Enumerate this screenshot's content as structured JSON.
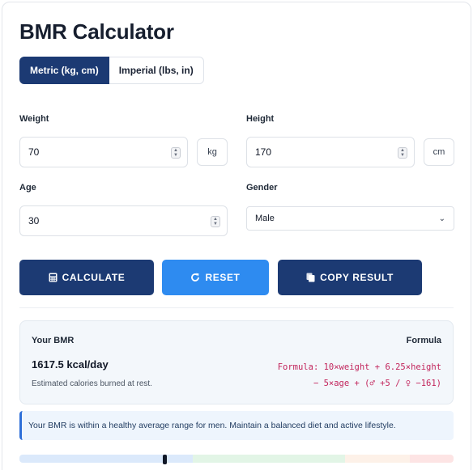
{
  "title": "BMR Calculator",
  "units": {
    "metric": "Metric (kg, cm)",
    "imperial": "Imperial (lbs, in)",
    "selected": "metric"
  },
  "fields": {
    "weight": {
      "label": "Weight",
      "value": "70",
      "unit": "kg"
    },
    "height": {
      "label": "Height",
      "value": "170",
      "unit": "cm"
    },
    "age": {
      "label": "Age",
      "value": "30"
    },
    "gender": {
      "label": "Gender",
      "value": "Male"
    }
  },
  "buttons": {
    "calculate": "CALCULATE",
    "reset": "RESET",
    "copy": "COPY RESULT"
  },
  "result": {
    "label": "Your BMR",
    "value": "1617.5 kcal/day",
    "note": "Estimated calories burned at rest.",
    "formula_label": "Formula",
    "formula_line1": "Formula: 10×weight + 6.25×height",
    "formula_line2": "− 5×age + (♂ +5 / ♀ −161)"
  },
  "message": "Your BMR is within a healthy average range for men. Maintain a balanced diet and active lifestyle.",
  "gauge": {
    "segments": [
      {
        "color": "#dbe9fb",
        "fraction": 0.4
      },
      {
        "color": "#e2f5e6",
        "fraction": 0.35
      },
      {
        "color": "#fdf1e8",
        "fraction": 0.15
      },
      {
        "color": "#fde4e4",
        "fraction": 0.1
      }
    ],
    "marker_fraction": 0.33
  },
  "colors": {
    "primary": "#1c3a73",
    "accent": "#2e8bf0",
    "formula": "#c2255c"
  }
}
